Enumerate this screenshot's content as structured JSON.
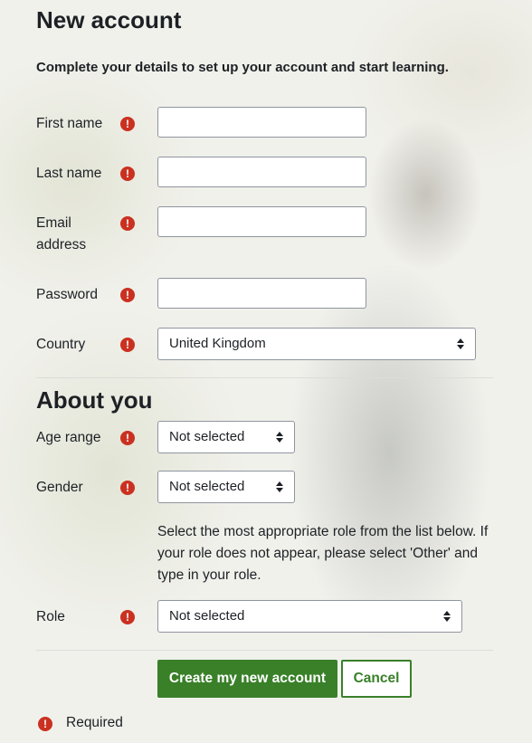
{
  "form": {
    "title": "New account",
    "intro": "Complete your details to set up your account and start learning.",
    "fields": {
      "first_name": {
        "label": "First name",
        "value": ""
      },
      "last_name": {
        "label": "Last name",
        "value": ""
      },
      "email": {
        "label": "Email address",
        "value": ""
      },
      "password": {
        "label": "Password",
        "value": ""
      },
      "country": {
        "label": "Country",
        "value": "United Kingdom"
      }
    },
    "about": {
      "title": "About you",
      "age_range": {
        "label": "Age range",
        "value": "Not selected"
      },
      "gender": {
        "label": "Gender",
        "value": "Not selected"
      },
      "role_help": "Select the most appropriate role from the list below. If your role does not appear, please select 'Other' and type in your role.",
      "role": {
        "label": "Role",
        "value": "Not selected"
      }
    },
    "buttons": {
      "submit": "Create my new account",
      "cancel": "Cancel"
    },
    "required_icon": "!",
    "required_legend": "Required"
  },
  "colors": {
    "primary": "#398029",
    "required": "#ca3120"
  },
  "icons": [
    "required-icon",
    "select-arrows-icon"
  ]
}
